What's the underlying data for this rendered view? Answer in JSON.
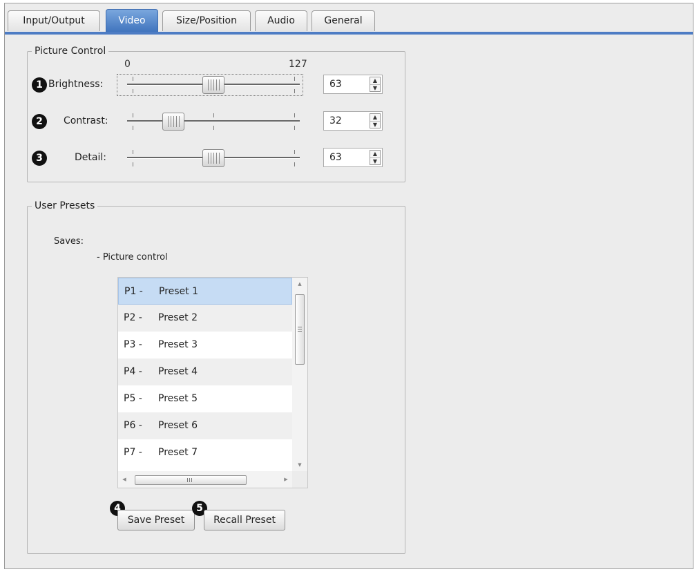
{
  "tabs": [
    {
      "label": "Input/Output",
      "active": false
    },
    {
      "label": "Video",
      "active": true
    },
    {
      "label": "Size/Position",
      "active": false
    },
    {
      "label": "Audio",
      "active": false
    },
    {
      "label": "General",
      "active": false
    }
  ],
  "picture_control": {
    "legend": "Picture Control",
    "scale_min": "0",
    "scale_max": "127",
    "rows": [
      {
        "marker": "1",
        "label": "Brightness:",
        "value": "63",
        "level_fraction": 0.5,
        "focused": true
      },
      {
        "marker": "2",
        "label": "Contrast:",
        "value": "32",
        "level_fraction": 0.25,
        "focused": false
      },
      {
        "marker": "3",
        "label": "Detail:",
        "value": "63",
        "level_fraction": 0.5,
        "focused": false
      }
    ]
  },
  "user_presets": {
    "legend": "User Presets",
    "saves_label": "Saves:",
    "saves_item": "- Picture control",
    "list": [
      {
        "code": "P1 -",
        "name": "Preset 1",
        "selected": true
      },
      {
        "code": "P2 -",
        "name": "Preset 2",
        "selected": false
      },
      {
        "code": "P3 -",
        "name": "Preset 3",
        "selected": false
      },
      {
        "code": "P4 -",
        "name": "Preset 4",
        "selected": false
      },
      {
        "code": "P5 -",
        "name": "Preset 5",
        "selected": false
      },
      {
        "code": "P6 -",
        "name": "Preset 6",
        "selected": false
      },
      {
        "code": "P7 -",
        "name": "Preset 7",
        "selected": false
      }
    ],
    "save_button": {
      "marker": "4",
      "label": "Save Preset"
    },
    "recall_button": {
      "marker": "5",
      "label": "Recall Preset"
    }
  },
  "icons": {
    "spin": "up-down-arrows-icon",
    "scroll_up": "scroll-up-arrow-icon",
    "scroll_down": "scroll-down-arrow-icon",
    "scroll_left": "scroll-left-arrow-icon",
    "scroll_right": "scroll-right-arrow-icon"
  },
  "colors": {
    "active_tab": "#4a7cc7",
    "selected_row": "#c6dcf4",
    "panel_bg": "#ececec"
  }
}
